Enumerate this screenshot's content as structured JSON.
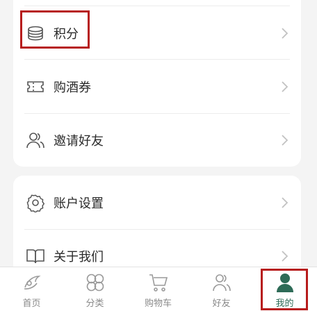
{
  "menu": {
    "points": {
      "label": "积分",
      "icon": "coins-stack-icon"
    },
    "wine_coupon": {
      "label": "购酒券",
      "icon": "ticket-icon"
    },
    "invite": {
      "label": "邀请好友",
      "icon": "friends-icon"
    },
    "account_settings": {
      "label": "账户设置",
      "icon": "gear-icon"
    },
    "about": {
      "label": "关于我们",
      "icon": "book-icon"
    }
  },
  "tabbar": {
    "items": [
      {
        "label": "首页",
        "icon": "home-logo-icon"
      },
      {
        "label": "分类",
        "icon": "category-icon"
      },
      {
        "label": "购物车",
        "icon": "cart-icon"
      },
      {
        "label": "好友",
        "icon": "friends-icon"
      },
      {
        "label": "我的",
        "icon": "profile-icon",
        "active": true
      }
    ]
  },
  "colors": {
    "accent": "#2e6b57",
    "highlight": "#b71c1c",
    "background": "#f4f4f4"
  }
}
